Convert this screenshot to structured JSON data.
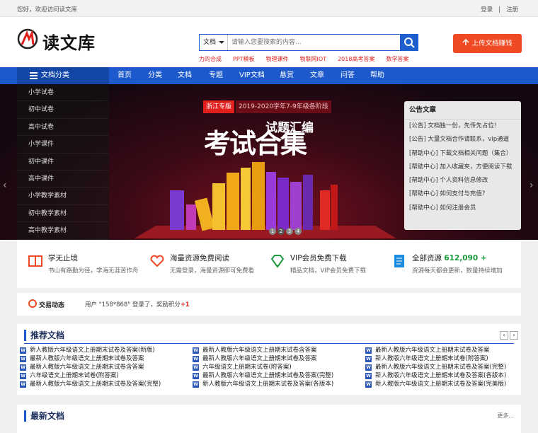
{
  "topbar": {
    "welcome": "您好，欢迎访问读文库",
    "login": "登录",
    "sep": "|",
    "register": "注册"
  },
  "header": {
    "logo_text": "读文库",
    "search_type": "文档",
    "search_placeholder": "请输入您要搜索的内容...",
    "hotwords": [
      "力的合成",
      "PPT模板",
      "物理课件",
      "物联网IOT",
      "2018高考答案",
      "数学答案"
    ],
    "upload_label": "上传文档赚钱"
  },
  "nav": {
    "category_label": "文档分类",
    "items": [
      "首页",
      "分类",
      "文档",
      "专题",
      "VIP文档",
      "悬赏",
      "文章",
      "问答",
      "帮助"
    ]
  },
  "category_menu": [
    "小学试卷",
    "初中试卷",
    "高中试卷",
    "小学课件",
    "初中课件",
    "高中课件",
    "小学教学素材",
    "初中教学素材",
    "高中教学素材"
  ],
  "banner": {
    "badge": "浙江专版",
    "subtitle": "2019-2020学年7-9年级各阶段",
    "big": "考试合集",
    "small": "试题汇编",
    "dots": [
      "1",
      "2",
      "3",
      "4"
    ],
    "active_dot": 2
  },
  "notice": {
    "title": "公告文章",
    "items": [
      "[公告] 文档独一份，先传先占位！",
      "[公告] 大量文档合作请联系，vip通道",
      "[帮助中心] 下载文档相关问题（集合）",
      "[帮助中心] 加入收藏夹，方便阅读下载",
      "[帮助中心] 个人资料信息修改",
      "[帮助中心] 如何支付与充值?",
      "[帮助中心] 如何注册会员"
    ]
  },
  "features": [
    {
      "title": "学无止境",
      "desc": "书山有路勤为径，学海无涯苦作舟",
      "icon": "book-icon"
    },
    {
      "title": "海量资源免费阅读",
      "desc": "无需登录，海量资源即可免费看",
      "icon": "heart-icon"
    },
    {
      "title": "VIP会员免费下载",
      "desc": "精品文档，VIP会员免费下载",
      "icon": "diamond-icon"
    },
    {
      "title": "全部资源",
      "count": "612,090 +",
      "desc": "资源每天都会更新，数量持续增加",
      "icon": "document-icon"
    }
  ],
  "trade": {
    "label": "交易动态",
    "message": "用户 \"158*868\" 登录了，奖励积分",
    "bonus": "+1"
  },
  "recommended": {
    "title": "推荐文档",
    "columns": [
      [
        "新人教版六年级语文上册期末试卷及答案(新版)",
        "最新人教版六年级语文上册期末试卷及答案",
        "最新人教版六年级语文上册期末试卷含答案",
        "六年级语文上册期末试卷(附答案)",
        "最新人教版六年级语文上册期末试卷及答案(完整)"
      ],
      [
        "最新人教版六年级语文上册期末试卷含答案",
        "最新人教版六年级语文上册期末试卷及答案",
        "六年级语文上册期末试卷(附答案)",
        "最新人教版六年级语文上册期末试卷及答案(完整)",
        "新人教版六年级语文上册期末试卷及答案(各版本)"
      ],
      [
        "最新人教版六年级语文上册期末试卷及答案",
        "新人教版六年级语文上册期末试卷(附答案)",
        "最新人教版六年级语文上册期末试卷及答案(完整)",
        "新人教版六年级语文上册期末试卷及答案(各版本)",
        "新人教版六年级语文上册期末试卷及答案(完美版)"
      ]
    ]
  },
  "latest": {
    "title": "最新文档",
    "more": "更多..."
  },
  "colors": {
    "brand_blue": "#1c59cc",
    "accent_orange": "#f04a24",
    "hot_red": "#e02020"
  }
}
